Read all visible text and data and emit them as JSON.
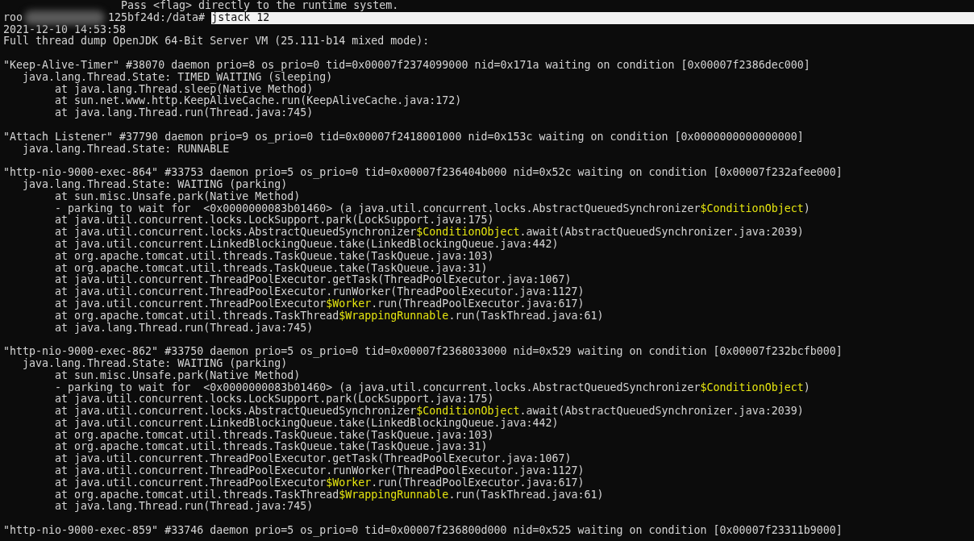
{
  "terminal": {
    "lines": [
      {
        "kind": "partial",
        "parts": [
          {
            "text": "Pass <flag> directly to the runtime system.",
            "kind": "normal"
          }
        ]
      },
      {
        "kind": "prompt",
        "user": "roo",
        "host": "125bf24d:/data#",
        "command": "jstack 12"
      },
      {
        "kind": "header",
        "parts": [
          {
            "text": "2021-12-10 14:53:58",
            "kind": "normal"
          }
        ]
      },
      {
        "kind": "header",
        "parts": [
          {
            "text": "Full thread dump OpenJDK 64-Bit Server VM (25.111-b14 mixed mode):",
            "kind": "normal"
          }
        ]
      },
      {
        "kind": "blank"
      },
      {
        "kind": "header",
        "parts": [
          {
            "text": "\"Keep-Alive-Timer\" #38070 daemon prio=8 os_prio=0 tid=0x00007f2374099000 nid=0x171a waiting on condition [0x00007f2386dec000]",
            "kind": "normal"
          }
        ]
      },
      {
        "kind": "state",
        "parts": [
          {
            "text": "java.lang.Thread.State: TIMED_WAITING (sleeping)",
            "kind": "normal"
          }
        ]
      },
      {
        "kind": "frame",
        "parts": [
          {
            "text": "at java.lang.Thread.sleep(Native Method)",
            "kind": "normal"
          }
        ]
      },
      {
        "kind": "frame",
        "parts": [
          {
            "text": "at sun.net.www.http.KeepAliveCache.run(KeepAliveCache.java:172)",
            "kind": "normal"
          }
        ]
      },
      {
        "kind": "frame",
        "parts": [
          {
            "text": "at java.lang.Thread.run(Thread.java:745)",
            "kind": "normal"
          }
        ]
      },
      {
        "kind": "blank"
      },
      {
        "kind": "header",
        "parts": [
          {
            "text": "\"Attach Listener\" #37790 daemon prio=9 os_prio=0 tid=0x00007f2418001000 nid=0x153c waiting on condition [0x0000000000000000]",
            "kind": "normal"
          }
        ]
      },
      {
        "kind": "state",
        "parts": [
          {
            "text": "java.lang.Thread.State: RUNNABLE",
            "kind": "normal"
          }
        ]
      },
      {
        "kind": "blank"
      },
      {
        "kind": "header",
        "parts": [
          {
            "text": "\"http-nio-9000-exec-864\" #33753 daemon prio=5 os_prio=0 tid=0x00007f236404b000 nid=0x52c waiting on condition [0x00007f232afee000]",
            "kind": "normal"
          }
        ]
      },
      {
        "kind": "state",
        "parts": [
          {
            "text": "java.lang.Thread.State: WAITING (parking)",
            "kind": "normal"
          }
        ]
      },
      {
        "kind": "frame",
        "parts": [
          {
            "text": "at sun.misc.Unsafe.park(Native Method)",
            "kind": "normal"
          }
        ]
      },
      {
        "kind": "frame",
        "parts": [
          {
            "text": "- parking to wait for  <0x0000000083b01460> (a java.util.concurrent.locks.AbstractQueuedSynchronizer",
            "kind": "normal"
          },
          {
            "text": "$ConditionObject",
            "kind": "inner-class"
          },
          {
            "text": ")",
            "kind": "normal"
          }
        ]
      },
      {
        "kind": "frame",
        "parts": [
          {
            "text": "at java.util.concurrent.locks.LockSupport.park(LockSupport.java:175)",
            "kind": "normal"
          }
        ]
      },
      {
        "kind": "frame",
        "parts": [
          {
            "text": "at java.util.concurrent.locks.AbstractQueuedSynchronizer",
            "kind": "normal"
          },
          {
            "text": "$ConditionObject",
            "kind": "inner-class"
          },
          {
            "text": ".await(AbstractQueuedSynchronizer.java:2039)",
            "kind": "normal"
          }
        ]
      },
      {
        "kind": "frame",
        "parts": [
          {
            "text": "at java.util.concurrent.LinkedBlockingQueue.take(LinkedBlockingQueue.java:442)",
            "kind": "normal"
          }
        ]
      },
      {
        "kind": "frame",
        "parts": [
          {
            "text": "at org.apache.tomcat.util.threads.TaskQueue.take(TaskQueue.java:103)",
            "kind": "normal"
          }
        ]
      },
      {
        "kind": "frame",
        "parts": [
          {
            "text": "at org.apache.tomcat.util.threads.TaskQueue.take(TaskQueue.java:31)",
            "kind": "normal"
          }
        ]
      },
      {
        "kind": "frame",
        "parts": [
          {
            "text": "at java.util.concurrent.ThreadPoolExecutor.getTask(ThreadPoolExecutor.java:1067)",
            "kind": "normal"
          }
        ]
      },
      {
        "kind": "frame",
        "parts": [
          {
            "text": "at java.util.concurrent.ThreadPoolExecutor.runWorker(ThreadPoolExecutor.java:1127)",
            "kind": "normal"
          }
        ]
      },
      {
        "kind": "frame",
        "parts": [
          {
            "text": "at java.util.concurrent.ThreadPoolExecutor",
            "kind": "normal"
          },
          {
            "text": "$Worker",
            "kind": "inner-class"
          },
          {
            "text": ".run(ThreadPoolExecutor.java:617)",
            "kind": "normal"
          }
        ]
      },
      {
        "kind": "frame",
        "parts": [
          {
            "text": "at org.apache.tomcat.util.threads.TaskThread",
            "kind": "normal"
          },
          {
            "text": "$WrappingRunnable",
            "kind": "inner-class"
          },
          {
            "text": ".run(TaskThread.java:61)",
            "kind": "normal"
          }
        ]
      },
      {
        "kind": "frame",
        "parts": [
          {
            "text": "at java.lang.Thread.run(Thread.java:745)",
            "kind": "normal"
          }
        ]
      },
      {
        "kind": "blank"
      },
      {
        "kind": "header",
        "parts": [
          {
            "text": "\"http-nio-9000-exec-862\" #33750 daemon prio=5 os_prio=0 tid=0x00007f2368033000 nid=0x529 waiting on condition [0x00007f232bcfb000]",
            "kind": "normal"
          }
        ]
      },
      {
        "kind": "state",
        "parts": [
          {
            "text": "java.lang.Thread.State: WAITING (parking)",
            "kind": "normal"
          }
        ]
      },
      {
        "kind": "frame",
        "parts": [
          {
            "text": "at sun.misc.Unsafe.park(Native Method)",
            "kind": "normal"
          }
        ]
      },
      {
        "kind": "frame",
        "parts": [
          {
            "text": "- parking to wait for  <0x0000000083b01460> (a java.util.concurrent.locks.AbstractQueuedSynchronizer",
            "kind": "normal"
          },
          {
            "text": "$ConditionObject",
            "kind": "inner-class"
          },
          {
            "text": ")",
            "kind": "normal"
          }
        ]
      },
      {
        "kind": "frame",
        "parts": [
          {
            "text": "at java.util.concurrent.locks.LockSupport.park(LockSupport.java:175)",
            "kind": "normal"
          }
        ]
      },
      {
        "kind": "frame",
        "parts": [
          {
            "text": "at java.util.concurrent.locks.AbstractQueuedSynchronizer",
            "kind": "normal"
          },
          {
            "text": "$ConditionObject",
            "kind": "inner-class"
          },
          {
            "text": ".await(AbstractQueuedSynchronizer.java:2039)",
            "kind": "normal"
          }
        ]
      },
      {
        "kind": "frame",
        "parts": [
          {
            "text": "at java.util.concurrent.LinkedBlockingQueue.take(LinkedBlockingQueue.java:442)",
            "kind": "normal"
          }
        ]
      },
      {
        "kind": "frame",
        "parts": [
          {
            "text": "at org.apache.tomcat.util.threads.TaskQueue.take(TaskQueue.java:103)",
            "kind": "normal"
          }
        ]
      },
      {
        "kind": "frame",
        "parts": [
          {
            "text": "at org.apache.tomcat.util.threads.TaskQueue.take(TaskQueue.java:31)",
            "kind": "normal"
          }
        ]
      },
      {
        "kind": "frame",
        "parts": [
          {
            "text": "at java.util.concurrent.ThreadPoolExecutor.getTask(ThreadPoolExecutor.java:1067)",
            "kind": "normal"
          }
        ]
      },
      {
        "kind": "frame",
        "parts": [
          {
            "text": "at java.util.concurrent.ThreadPoolExecutor.runWorker(ThreadPoolExecutor.java:1127)",
            "kind": "normal"
          }
        ]
      },
      {
        "kind": "frame",
        "parts": [
          {
            "text": "at java.util.concurrent.ThreadPoolExecutor",
            "kind": "normal"
          },
          {
            "text": "$Worker",
            "kind": "inner-class"
          },
          {
            "text": ".run(ThreadPoolExecutor.java:617)",
            "kind": "normal"
          }
        ]
      },
      {
        "kind": "frame",
        "parts": [
          {
            "text": "at org.apache.tomcat.util.threads.TaskThread",
            "kind": "normal"
          },
          {
            "text": "$WrappingRunnable",
            "kind": "inner-class"
          },
          {
            "text": ".run(TaskThread.java:61)",
            "kind": "normal"
          }
        ]
      },
      {
        "kind": "frame",
        "parts": [
          {
            "text": "at java.lang.Thread.run(Thread.java:745)",
            "kind": "normal"
          }
        ]
      },
      {
        "kind": "blank"
      },
      {
        "kind": "header",
        "parts": [
          {
            "text": "\"http-nio-9000-exec-859\" #33746 daemon prio=5 os_prio=0 tid=0x00007f236800d000 nid=0x525 waiting on condition [0x00007f23311b9000]",
            "kind": "normal"
          }
        ]
      }
    ]
  }
}
